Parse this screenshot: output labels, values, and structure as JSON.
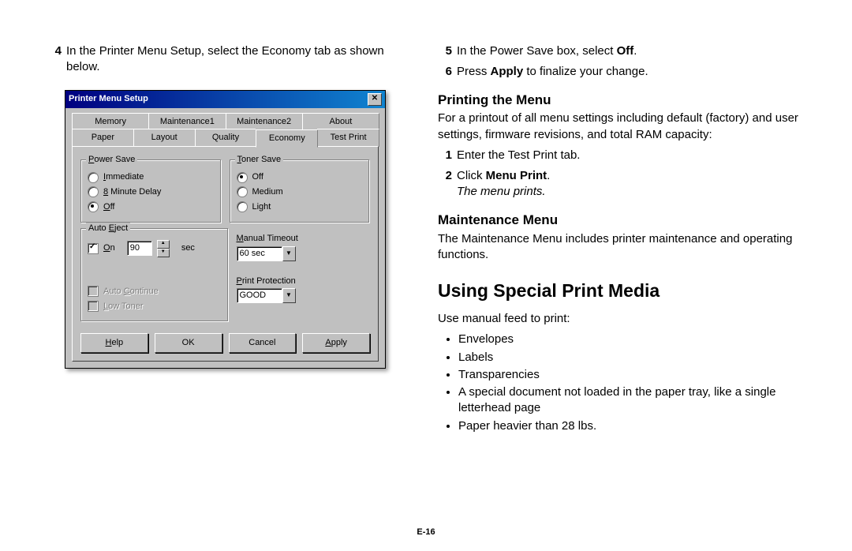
{
  "left": {
    "step4_num": "4",
    "step4_text": "In the Printer Menu Setup, select the Economy tab as shown below."
  },
  "dialog": {
    "title": "Printer Menu Setup",
    "tabs_row1": [
      "Memory",
      "Maintenance1",
      "Maintenance2",
      "About"
    ],
    "tabs_row2": [
      "Paper",
      "Layout",
      "Quality",
      "Economy",
      "Test Print"
    ],
    "active_tab": "Economy",
    "power_save": {
      "legend_prefix": "P",
      "legend_rest": "ower Save",
      "options": [
        {
          "label_u": "I",
          "label_rest": "mmediate",
          "selected": false
        },
        {
          "label_u": "8",
          "label_rest": " Minute Delay",
          "selected": false
        },
        {
          "label_u": "O",
          "label_rest": "ff",
          "selected": true
        }
      ]
    },
    "toner_save": {
      "legend_prefix": "T",
      "legend_rest": "oner Save",
      "options": [
        {
          "label": "Off",
          "selected": true
        },
        {
          "label": "Medium",
          "selected": false
        },
        {
          "label": "Light",
          "selected": false
        }
      ]
    },
    "auto_eject": {
      "legend_u": "E",
      "legend_pre": "Auto ",
      "legend_post": "ject",
      "on_label_u": "O",
      "on_label_rest": "n",
      "on_checked": true,
      "value": "90",
      "unit": "sec"
    },
    "manual_timeout": {
      "label_u": "M",
      "label_rest": "anual Timeout",
      "value": "60 sec"
    },
    "print_protection": {
      "label_u": "P",
      "label_pre": "",
      "label_rest": "rint Protection",
      "value": "GOOD"
    },
    "auto_continue": {
      "label_u": "C",
      "label_pre": "Auto ",
      "label_rest": "ontinue",
      "checked": false
    },
    "low_toner": {
      "label_u": "L",
      "label_rest": "ow Toner",
      "checked": false
    },
    "buttons": {
      "help_u": "H",
      "help_rest": "elp",
      "ok": "OK",
      "cancel": "Cancel",
      "apply_u": "A",
      "apply_rest": "pply"
    }
  },
  "right": {
    "step5_num": "5",
    "step5_a": "In the Power Save box, select ",
    "step5_b": "Off",
    "step5_c": ".",
    "step6_num": "6",
    "step6_a": "Press ",
    "step6_b": "Apply",
    "step6_c": " to finalize your change.",
    "h_print": "Printing the Menu",
    "print_intro": "For a printout of all menu settings including default (factory) and user settings, firmware revisions, and total RAM capacity:",
    "p1_num": "1",
    "p1_text": "Enter the Test Print tab.",
    "p2_num": "2",
    "p2_a": "Click ",
    "p2_b": "Menu Print",
    "p2_c": ".",
    "p2_result": "The menu prints.",
    "h_maint": "Maintenance Menu",
    "maint_text": "The Maintenance Menu includes printer maintenance and operating functions.",
    "h_special": "Using Special Print Media",
    "special_intro": "Use manual feed to print:",
    "bullets": [
      "Envelopes",
      "Labels",
      "Transparencies",
      "A special document not loaded in the paper tray, like a single letterhead page",
      "Paper heavier than 28 lbs."
    ]
  },
  "pagenum": "E-16"
}
